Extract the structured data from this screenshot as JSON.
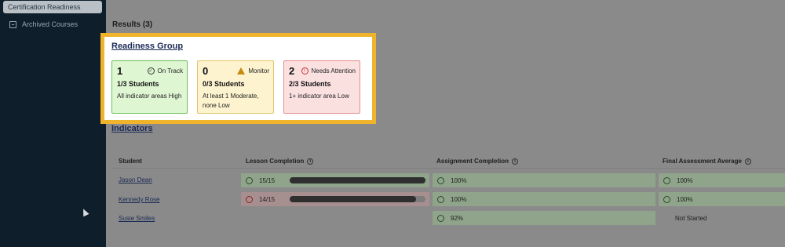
{
  "sidebar": {
    "active_item": "Certification Readiness",
    "items": [
      {
        "label": "Archived Courses",
        "icon": "archive-icon"
      }
    ]
  },
  "results": {
    "title": "Results (3)"
  },
  "readiness_group": {
    "title": "Readiness Group",
    "cards": [
      {
        "count": "1",
        "status": "On Track",
        "students": "1/3 Students",
        "description": "All indicator areas High",
        "icon": "check-circle-icon"
      },
      {
        "count": "0",
        "status": "Monitor",
        "students": "0/3 Students",
        "description": "At least 1 Moderate, none Low",
        "icon": "warning-triangle-icon"
      },
      {
        "count": "2",
        "status": "Needs Attention",
        "students": "2/3 Students",
        "description": "1+ indicator area Low",
        "icon": "alert-circle-icon"
      }
    ]
  },
  "indicators": {
    "title": "Indicators",
    "columns": [
      "Student",
      "Lesson Completion",
      "Assignment Completion",
      "Final Assessment Average"
    ],
    "rows": [
      {
        "student": "Jason Dean",
        "lesson": "15/15",
        "lesson_fraction": 1.0,
        "lesson_status": "ok",
        "assignment": "100%",
        "final": "100%"
      },
      {
        "student": "Kennedy Rose",
        "lesson": "14/15",
        "lesson_fraction": 0.933,
        "lesson_status": "bad",
        "assignment": "100%",
        "final": "100%"
      },
      {
        "student": "Susie Smiles",
        "lesson": "",
        "lesson_fraction": 0,
        "lesson_status": "none",
        "assignment": "92%",
        "final": "Not Started"
      }
    ]
  }
}
